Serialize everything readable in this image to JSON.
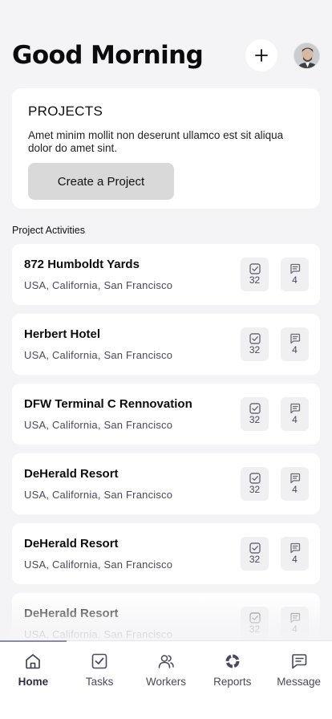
{
  "header": {
    "greeting": "Good Morning"
  },
  "projects": {
    "title": "PROJECTS",
    "description": "Amet minim mollit non deserunt ullamco est sit aliqua dolor do amet sint.",
    "create_label": "Create a Project"
  },
  "activities_label": "Project Activities",
  "activities": [
    {
      "name": "872 Humboldt Yards",
      "location": "USA, California, San Francisco",
      "tasks": "32",
      "messages": "4"
    },
    {
      "name": "Herbert Hotel",
      "location": "USA, California, San Francisco",
      "tasks": "32",
      "messages": "4"
    },
    {
      "name": "DFW Terminal C Rennovation",
      "location": "USA, California, San Francisco",
      "tasks": "32",
      "messages": "4"
    },
    {
      "name": "DeHerald Resort",
      "location": "USA, California, San Francisco",
      "tasks": "32",
      "messages": "4"
    },
    {
      "name": "DeHerald Resort",
      "location": "USA, California, San Francisco",
      "tasks": "32",
      "messages": "4"
    },
    {
      "name": "DeHerald Resort",
      "location": "USA, California, San Francisco",
      "tasks": "32",
      "messages": "4"
    }
  ],
  "nav": [
    {
      "label": "Home",
      "icon": "home-icon",
      "active": true
    },
    {
      "label": "Tasks",
      "icon": "tasks-icon",
      "active": false
    },
    {
      "label": "Workers",
      "icon": "workers-icon",
      "active": false
    },
    {
      "label": "Reports",
      "icon": "reports-icon",
      "active": false
    },
    {
      "label": "Message",
      "icon": "message-icon",
      "active": false
    }
  ],
  "colors": {
    "background": "#f4f4f6",
    "card": "#ffffff",
    "muted_text": "#4a4a5c",
    "button": "#d9d9d9",
    "active_nav": "#2e2e44"
  }
}
